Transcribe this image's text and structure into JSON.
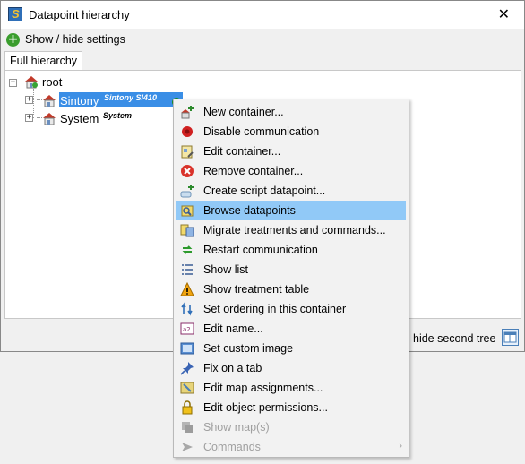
{
  "window": {
    "title": "Datapoint hierarchy",
    "close_glyph": "✕"
  },
  "toolbar": {
    "settings_label": "Show / hide settings"
  },
  "tabs": [
    {
      "label": "Full hierarchy",
      "active": true
    }
  ],
  "tree": {
    "root": "root",
    "children": [
      {
        "label": "Sintony",
        "tag": "Sintony SI410",
        "selected": true,
        "status": "connected"
      },
      {
        "label": "System",
        "tag": "System",
        "selected": false
      }
    ]
  },
  "footer": {
    "second_tree_label": "hide second tree"
  },
  "context_menu": {
    "items": [
      {
        "label": "New container...",
        "icon": "new-container-icon",
        "enabled": true
      },
      {
        "label": "Disable communication",
        "icon": "disable-communication-icon",
        "enabled": true
      },
      {
        "label": "Edit container...",
        "icon": "edit-container-icon",
        "enabled": true
      },
      {
        "label": "Remove container...",
        "icon": "remove-icon",
        "enabled": true
      },
      {
        "label": "Create script datapoint...",
        "icon": "script-datapoint-icon",
        "enabled": true
      },
      {
        "label": "Browse datapoints",
        "icon": "browse-datapoints-icon",
        "enabled": true,
        "highlighted": true
      },
      {
        "label": "Migrate treatments and commands...",
        "icon": "migrate-icon",
        "enabled": true
      },
      {
        "label": "Restart communication",
        "icon": "restart-icon",
        "enabled": true
      },
      {
        "label": "Show list",
        "icon": "list-icon",
        "enabled": true
      },
      {
        "label": "Show treatment table",
        "icon": "warning-icon",
        "enabled": true
      },
      {
        "label": "Set ordering in this container",
        "icon": "sort-icon",
        "enabled": true
      },
      {
        "label": "Edit name...",
        "icon": "rename-icon",
        "enabled": true
      },
      {
        "label": "Set custom image",
        "icon": "image-icon",
        "enabled": true
      },
      {
        "label": "Fix on a tab",
        "icon": "pin-icon",
        "enabled": true
      },
      {
        "label": "Edit map assignments...",
        "icon": "map-icon",
        "enabled": true
      },
      {
        "label": "Edit object permissions...",
        "icon": "lock-icon",
        "enabled": true
      },
      {
        "label": "Show map(s)",
        "icon": "show-maps-icon",
        "enabled": false
      },
      {
        "label": "Commands",
        "icon": "commands-icon",
        "enabled": false,
        "submenu": true
      }
    ]
  },
  "colors": {
    "selection": "#3a8ee6",
    "menu_highlight": "#91c9f7",
    "status_green": "#2fd02f"
  }
}
